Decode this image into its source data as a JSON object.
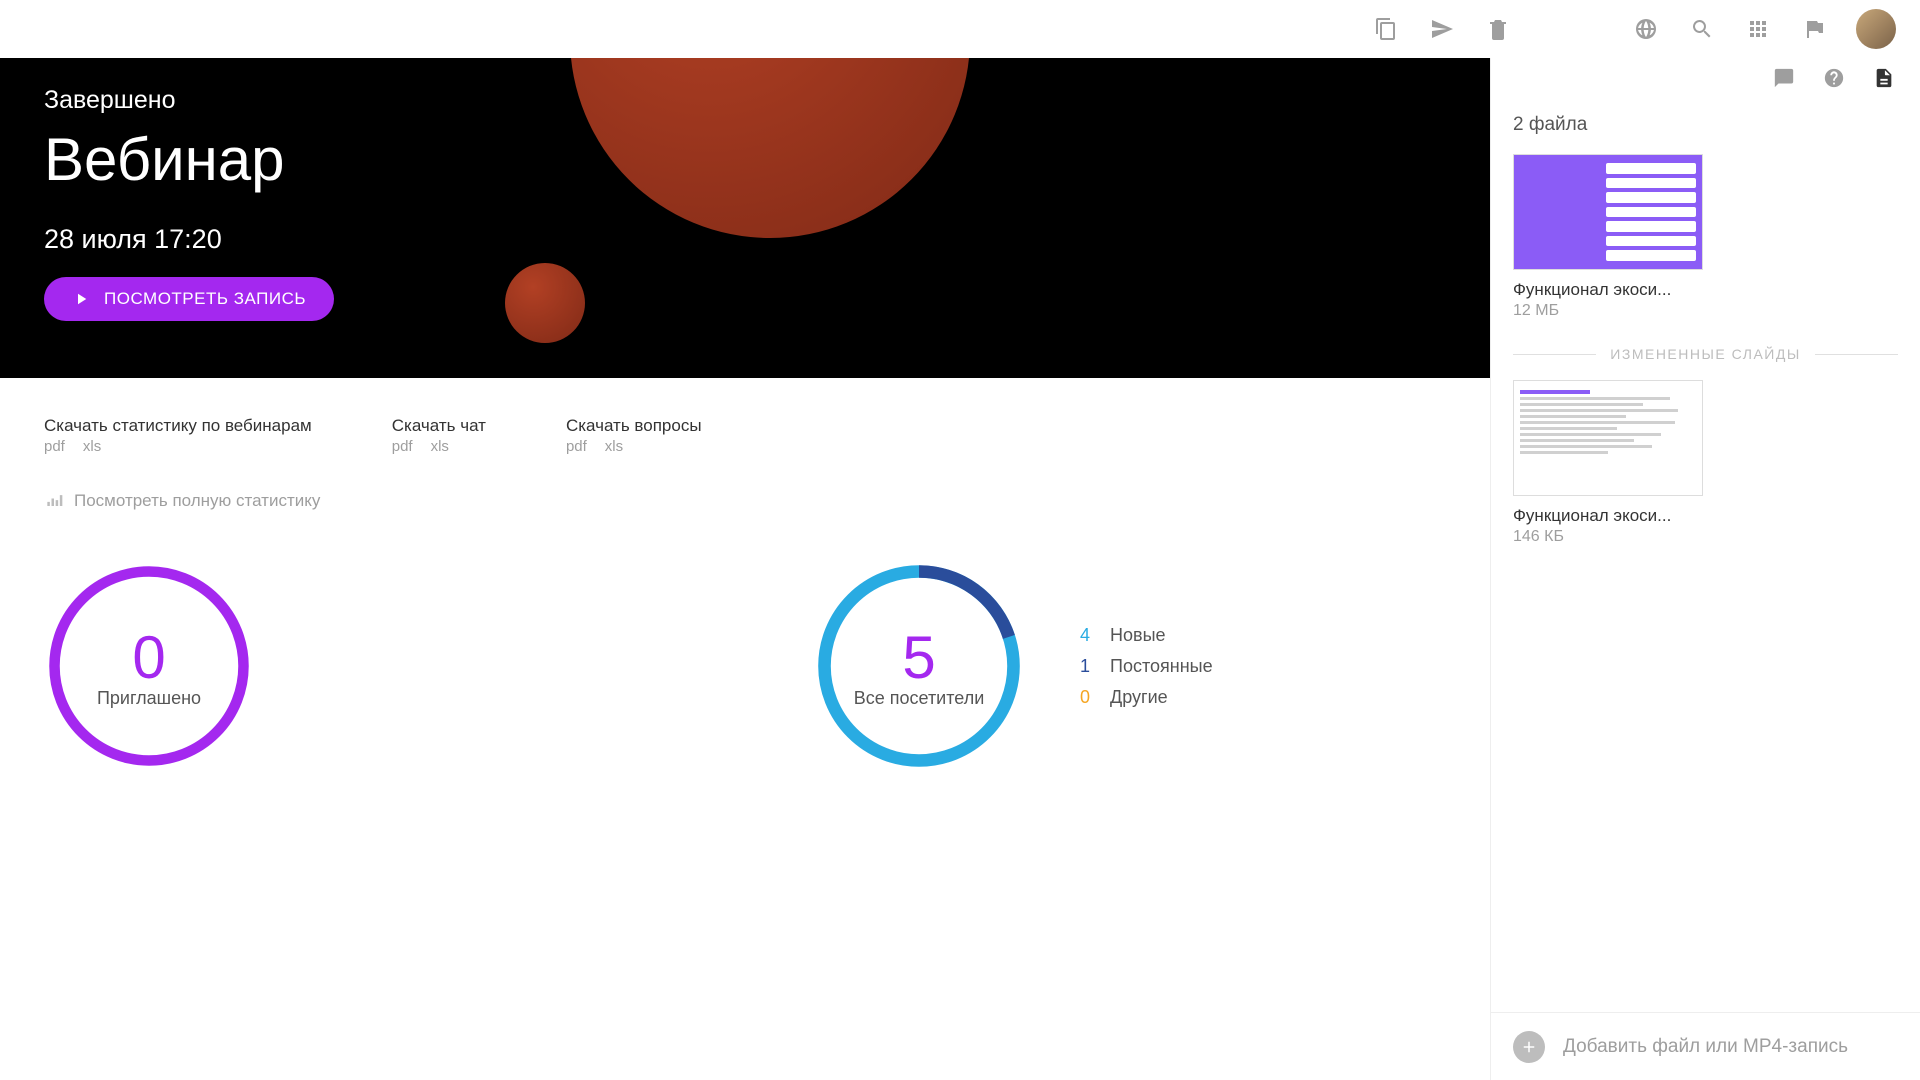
{
  "topbar": {
    "icons": [
      "copy",
      "send",
      "trash",
      "globe",
      "search",
      "apps",
      "flag"
    ]
  },
  "hero": {
    "status": "Завершено",
    "title": "Вебинар",
    "datetime": "28 июля 17:20",
    "watch_label": "ПОСМОТРЕТЬ ЗАПИСЬ"
  },
  "downloads": [
    {
      "label": "Скачать статистику по вебинарам",
      "pdf": "pdf",
      "xls": "xls"
    },
    {
      "label": "Скачать чат",
      "pdf": "pdf",
      "xls": "xls"
    },
    {
      "label": "Скачать вопросы",
      "pdf": "pdf",
      "xls": "xls"
    }
  ],
  "full_stats_label": "Посмотреть полную статистику",
  "chart_data": [
    {
      "type": "pie",
      "title": "Приглашено",
      "series": [
        {
          "name": "Приглашено",
          "values": [
            0
          ]
        }
      ],
      "total": 0,
      "colors": [
        "#a428ef"
      ]
    },
    {
      "type": "pie",
      "title": "Все посетители",
      "total": 5,
      "series": [
        {
          "name": "Новые",
          "values": [
            4
          ],
          "color": "#29abe2"
        },
        {
          "name": "Постоянные",
          "values": [
            1
          ],
          "color": "#2a4d9b"
        },
        {
          "name": "Другие",
          "values": [
            0
          ],
          "color": "#f5a623"
        }
      ]
    }
  ],
  "invited": {
    "value": "0",
    "caption": "Приглашено"
  },
  "visitors": {
    "value": "5",
    "caption": "Все посетители",
    "legend": [
      {
        "count": "4",
        "label": "Новые",
        "cls": "c-blue"
      },
      {
        "count": "1",
        "label": "Постоянные",
        "cls": "c-navy"
      },
      {
        "count": "0",
        "label": "Другие",
        "cls": "c-orange"
      }
    ]
  },
  "sidebar": {
    "files_count": "2 файла",
    "files": [
      {
        "name": "Функционал экоси...",
        "size": "12 МБ"
      },
      {
        "name": "Функционал экоси...",
        "size": "146 КБ"
      }
    ],
    "changed_slides": "ИЗМЕНЕННЫЕ СЛАЙДЫ",
    "add_file": "Добавить файл или MP4-запись"
  }
}
